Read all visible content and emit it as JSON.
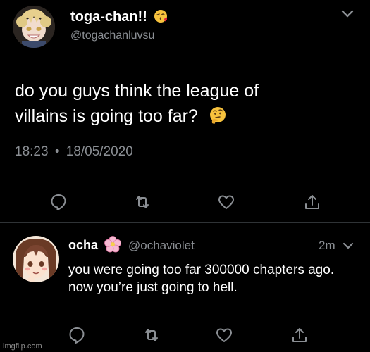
{
  "main_tweet": {
    "display_name": "toga-chan!!",
    "name_emoji_icon": "kissing-face-emoji-icon",
    "handle": "@togachanluvsu",
    "text_line1": "do you guys think the league of",
    "text_line2": "villains is going too far?",
    "text_emoji_icon": "thinking-face-emoji-icon",
    "time": "18:23",
    "separator": "•",
    "date": "18/05/2020",
    "actions": [
      "reply-icon",
      "retweet-icon",
      "like-icon",
      "share-icon"
    ]
  },
  "reply_tweet": {
    "display_name": "ocha",
    "name_emoji_icon": "cherry-blossom-emoji-icon",
    "handle": "@ochaviolet",
    "time": "2m",
    "text": "you were going too far 300000 chapters ago. now you’re just going to hell.",
    "actions": [
      "reply-icon",
      "retweet-icon",
      "like-icon",
      "share-icon"
    ]
  },
  "watermark": "imgflip.com",
  "colors": {
    "background": "#000000",
    "primary_text": "#ffffff",
    "secondary_text": "#8b8f94",
    "divider": "#2f3336"
  }
}
